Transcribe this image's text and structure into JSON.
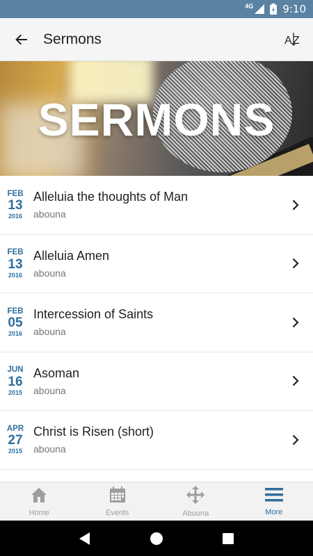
{
  "status_bar": {
    "network": "4G",
    "time": "9:10"
  },
  "app_bar": {
    "title": "Sermons",
    "back_icon": "arrow-back-icon",
    "sort_icon": "sort-az-icon"
  },
  "banner": {
    "title": "SERMONS"
  },
  "sermons": [
    {
      "month": "FEB",
      "day": "13",
      "year": "2016",
      "title": "Alleluia the thoughts of Man",
      "author": "abouna"
    },
    {
      "month": "FEB",
      "day": "13",
      "year": "2016",
      "title": "Alleluia Amen",
      "author": "abouna"
    },
    {
      "month": "FEB",
      "day": "05",
      "year": "2016",
      "title": "Intercession of Saints",
      "author": "abouna"
    },
    {
      "month": "JUN",
      "day": "16",
      "year": "2015",
      "title": "Asoman",
      "author": "abouna"
    },
    {
      "month": "APR",
      "day": "27",
      "year": "2015",
      "title": "Christ is Risen (short)",
      "author": "abouna"
    }
  ],
  "bottom_nav": [
    {
      "label": "Home",
      "icon": "home-icon",
      "active": false
    },
    {
      "label": "Events",
      "icon": "calendar-icon",
      "active": false
    },
    {
      "label": "Abouna",
      "icon": "move-arrows-icon",
      "active": false
    },
    {
      "label": "More",
      "icon": "menu-icon",
      "active": true
    }
  ],
  "colors": {
    "accent": "#2f6e9c",
    "status_bar": "#5b82a3",
    "inactive_nav": "#9e9e9e"
  }
}
